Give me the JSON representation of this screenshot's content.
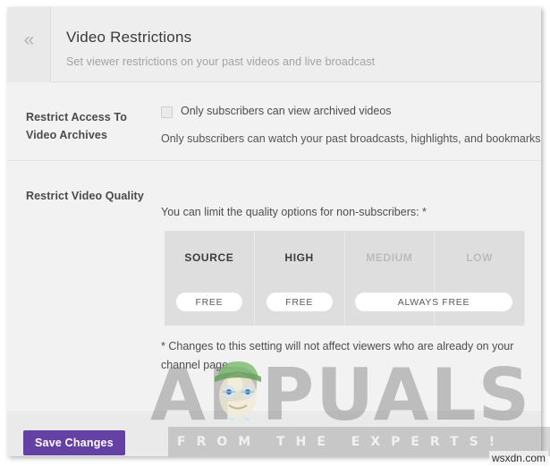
{
  "header": {
    "collapse_icon": "chevron-double-left-icon",
    "collapse_glyph": "«",
    "title": "Video Restrictions",
    "subtitle": "Set viewer restrictions on your past videos and live broadcast"
  },
  "sections": {
    "archives": {
      "label": "Restrict Access To Video Archives",
      "checkbox": {
        "label": "Only subscribers can view archived videos",
        "checked": false
      },
      "help_text": "Only subscribers can watch your past broadcasts, highlights, and bookmarks."
    },
    "quality": {
      "label": "Restrict Video Quality",
      "intro": "You can limit the quality options for non-subscribers: *",
      "columns": [
        {
          "name": "SOURCE",
          "enabled": true,
          "pill": "FREE"
        },
        {
          "name": "HIGH",
          "enabled": true,
          "pill": "FREE"
        },
        {
          "name": "MEDIUM",
          "enabled": false,
          "pill": null
        },
        {
          "name": "LOW",
          "enabled": false,
          "pill": null
        }
      ],
      "span_pill": "ALWAYS FREE",
      "note": "* Changes to this setting will not affect viewers who are already on your channel page."
    }
  },
  "footer": {
    "save_label": "Save Changes"
  },
  "watermark": {
    "brand": "APPUALS",
    "tagline": "FROM THE EXPERTS!",
    "site": "wsxdn.com"
  },
  "colors": {
    "brand_purple": "#6441a4",
    "card_bg": "#f2f2f2",
    "header_bg": "#eeeeee",
    "table_bg": "#dedede",
    "footer_bg": "#eaeaea",
    "text_primary": "#4a4a4a",
    "text_muted": "#a3a3a3",
    "disabled_text": "#bcbcbc"
  }
}
